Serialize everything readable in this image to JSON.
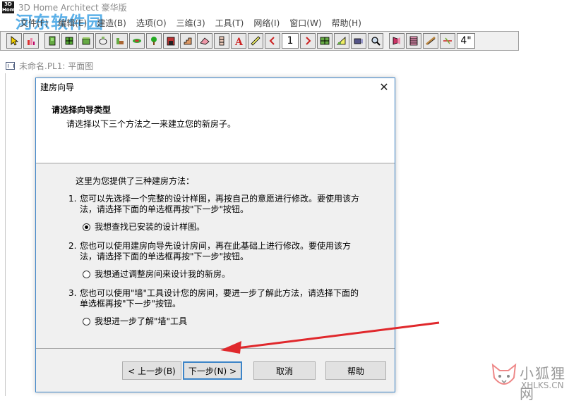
{
  "app": {
    "logo_top": "3D",
    "logo_bottom": "Home",
    "title": "3D Home Architect 豪华版",
    "watermark": "河东软件园"
  },
  "menu": [
    "文件(F)",
    "编辑(E)",
    "建造(B)",
    "选项(O)",
    "三维(3)",
    "工具(T)",
    "网络(I)",
    "窗口(W)",
    "帮助(H)"
  ],
  "toolbar": {
    "page_number": "1",
    "size_value": "4\"",
    "icons": [
      "pointer-icon",
      "chart-icon",
      "door-icon",
      "window-icon",
      "cabinet-icon",
      "fixture-icon",
      "furniture-icon",
      "plant-icon",
      "tree-icon",
      "fireplace-icon",
      "stairs-icon",
      "roof-icon",
      "column-icon",
      "text-icon",
      "ruler-icon",
      "prev-page-icon",
      "next-page-icon",
      "plan-icon",
      "elevation-icon",
      "camera-icon",
      "zoom-icon",
      "floor-icon",
      "staircase-icon",
      "railing-icon",
      "dimension-icon"
    ]
  },
  "document": {
    "tab_title": "未命名.PL1: 平面图"
  },
  "dialog": {
    "title": "建房向导",
    "heading": "请选择向导类型",
    "subheading": "请选择以下三个方法之一来建立您的新房子。",
    "intro": "这里为您提供了三种建房方法：",
    "options": [
      {
        "num": "1.",
        "line1": "您可以先选择一个完整的设计样图，再按自己的意愿进行修改。要使用该方",
        "line2": "法，请选择下面的单选框再按\"下一步\"按钮。",
        "radio": "我想查找已安装的设计样图。",
        "selected": true
      },
      {
        "num": "2.",
        "line1": "您也可以使用建房向导先设计房间，再在此基础上进行修改。要使用该方",
        "line2": "法，请选择下面的单选框再按\"下一步\"按钮。",
        "radio": "我想通过调整房间来设计我的新房。",
        "selected": false
      },
      {
        "num": "3.",
        "line1": "您也可以使用\"墙\"工具设计您的房间，要进一步了解此方法，请选择下面的",
        "line2": "单选框再按\"下一步\"按钮。",
        "radio": "我想进一步了解\"墙\"工具",
        "selected": false
      }
    ],
    "buttons": {
      "back": "< 上一步(B)",
      "next": "下一步(N) >",
      "cancel": "取消",
      "help": "帮助"
    },
    "close_glyph": "✕"
  },
  "site": {
    "name": "小狐狸网",
    "url": "XHLKS.CN"
  },
  "colors": {
    "accent": "#3c84c8",
    "arrow": "#e0282c",
    "watermark": "#4aa8e6"
  }
}
